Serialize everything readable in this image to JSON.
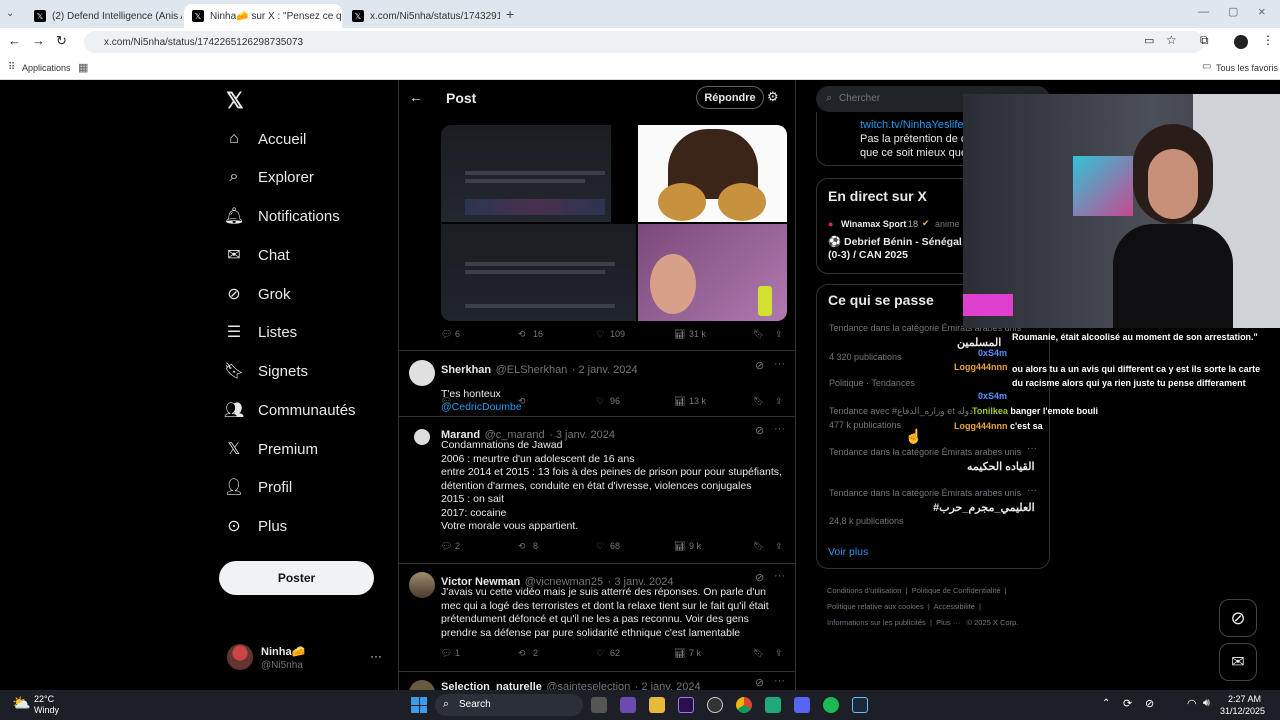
{
  "browser": {
    "tabs": [
      {
        "label": "(2) Defend Intelligence (Anis A…",
        "active": false
      },
      {
        "label": "Ninha🧀 sur X : \"Pensez ce qu…",
        "active": true
      },
      {
        "label": "x.com/Ni5nha/status/17432918…",
        "active": false
      }
    ],
    "url": "x.com/Ni5nha/status/1742265126298735073",
    "bookmarks_apps": "Applications",
    "bookmarks_all": "Tous les favoris"
  },
  "nav": {
    "items": [
      "Accueil",
      "Explorer",
      "Notifications",
      "Chat",
      "Grok",
      "Listes",
      "Signets",
      "Communautés",
      "Premium",
      "Profil",
      "Plus"
    ],
    "poster_label": "Poster",
    "user_name": "Ninha🧀",
    "user_handle": "@Ni5nha"
  },
  "header": {
    "title": "Post",
    "reply_button": "Répondre"
  },
  "main_post_actions": {
    "replies": "6",
    "reposts": "16",
    "likes": "109",
    "views": "31 k"
  },
  "replies": [
    {
      "name": "Sherkhan",
      "handle": "@ELSherkhan",
      "date": "· 2 janv. 2024",
      "text": "T'es honteux",
      "mention": "@CedricDoumbe",
      "replies": "",
      "reposts": "",
      "likes": "96",
      "views": "13 k"
    },
    {
      "name": "Marand",
      "handle": "@c_marand",
      "date": "· 3 janv. 2024",
      "text": "Condamnations de Jawad\n2006 : meurtre d'un adolescent de 16 ans\nentre 2014 et 2015 : 13 fois à des peines de prison pour pour stupéfiants, détention d'armes, conduite en état d'ivresse, violences conjugales\n2015 : on sait\n2017: cocaine\nVotre morale vous appartient.",
      "replies": "2",
      "reposts": "8",
      "likes": "68",
      "views": "9 k"
    },
    {
      "name": "Victor Newman",
      "handle": "@vicnewman25",
      "date": "· 3 janv. 2024",
      "text": "J'avais vu cette vidéo mais je suis atterré des réponses. On parle d'un mec qui a logé des terroristes et dont la relaxe tient sur le fait qu'il était prétendument défoncé et qu'il ne les a pas reconnu. Voir des gens prendre sa défense par pure solidarité ethnique c'est lamentable",
      "replies": "1",
      "reposts": "2",
      "likes": "62",
      "views": "7 k"
    },
    {
      "name": "Selection_naturelle",
      "handle": "@sainteselection",
      "date": "· 2 janv. 2024"
    }
  ],
  "right": {
    "search_placeholder": "Chercher",
    "bio_link": "twitch.tv/NinhaYeslife",
    "bio_line1": "Pas la prétention de co",
    "bio_line2": "que ce soit mieux que r",
    "live_title": "En direct sur X",
    "live_host": "Winamax Sport",
    "live_badge": "18",
    "live_host_suffix": "anime",
    "live_event": "⚽ Debrief Bénin - Sénégal (0-3) / CAN 2025",
    "trends_title": "Ce qui se passe",
    "trends": [
      {
        "meta": "Tendance dans la catégorie Émirats arabes unis",
        "name": "المسلمين",
        "count": "4 320 publications"
      },
      {
        "meta": "Politique · Tendances",
        "name": "",
        "count": ""
      },
      {
        "meta": "Tendance avec #وزاره_الدفاع et دوله",
        "name": "",
        "count": "477 k publications"
      },
      {
        "meta": "Tendance dans la catégorie Émirats arabes unis",
        "name": "القياده الحكيمه",
        "count": ""
      },
      {
        "meta": "Tendance dans la catégorie Émirats arabes unis",
        "name": "#العليمي_مجرم_حرب",
        "count": "24,8 k publications"
      }
    ],
    "show_more": "Voir plus",
    "footer": [
      "Conditions d'utilisation",
      "Politique de Confidentialité",
      "Politique relative aux cookies",
      "Accessibilité",
      "Informations sur les publicités",
      "Plus ···",
      "© 2025 X Corp."
    ]
  },
  "stream_chat": [
    {
      "user": "",
      "text": "Roumanie, était alcoolisé au moment de son arrestation.\""
    },
    {
      "user": "0xS4m",
      "text": ""
    },
    {
      "user": "Logg444nnn",
      "text": "ou alors tu a un avis qui different ca y est ils sorte la carte du racisme alors qui ya rien juste tu pense differament"
    },
    {
      "user": "0xS4m",
      "text": ""
    },
    {
      "user": "Tonilkea",
      "text": "banger l'emote bouli"
    },
    {
      "user": "Logg444nnn",
      "text": "c'est sa"
    }
  ],
  "taskbar": {
    "weather_temp": "22°C",
    "weather_desc": "Windy",
    "search_label": "Search",
    "time": "2:27 AM",
    "date": "31/12/2025"
  },
  "colors": {
    "accent": "#1d9bf0",
    "bg": "#000000",
    "border": "#2f3336"
  }
}
